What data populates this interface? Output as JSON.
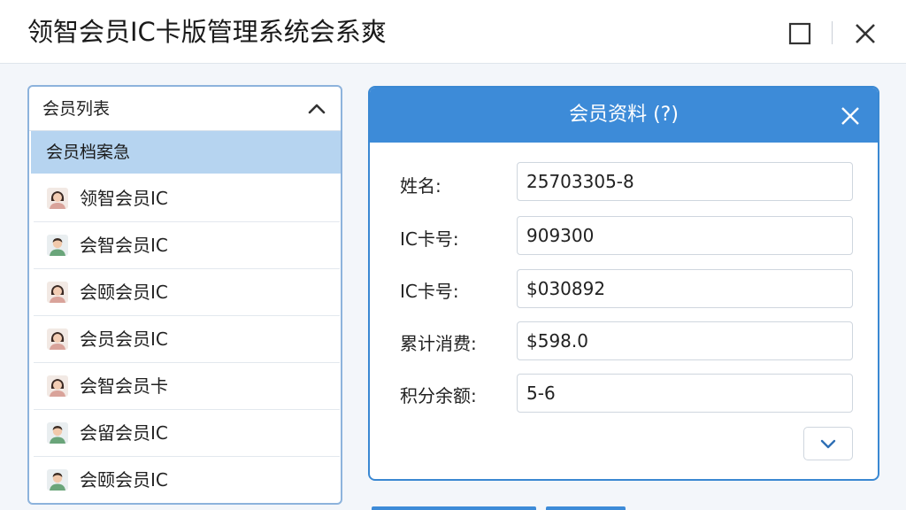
{
  "window": {
    "title": "领智会员IC卡版管理系统会系爽"
  },
  "list": {
    "header_label": "会员列表",
    "section_label": "会员档案急",
    "members": [
      {
        "name": "领智会员IC",
        "avatar": "female-avatar-icon"
      },
      {
        "name": "会智会员IC",
        "avatar": "male-avatar-icon"
      },
      {
        "name": "会颐会员IC",
        "avatar": "female-avatar-icon"
      },
      {
        "name": "会员会员IC",
        "avatar": "female-avatar-icon"
      },
      {
        "name": "会智会员卡",
        "avatar": "female-avatar-icon"
      },
      {
        "name": "会留会员IC",
        "avatar": "male-avatar-icon"
      },
      {
        "name": "会颐会员IC",
        "avatar": "male-avatar-icon"
      }
    ]
  },
  "dialog": {
    "title": "会员资料 (?)",
    "fields": [
      {
        "label": "姓名:",
        "value": "25703305-8"
      },
      {
        "label": "IC卡号:",
        "value": "909300"
      },
      {
        "label": "IC卡号:",
        "value": "$030892"
      },
      {
        "label": "累计消费:",
        "value": "$598.0"
      },
      {
        "label": "积分余额:",
        "value": "5-6"
      }
    ]
  },
  "colors": {
    "accent": "#3d8bd8",
    "selected_row": "#b6d4f0",
    "panel_border": "#8db3dc"
  }
}
